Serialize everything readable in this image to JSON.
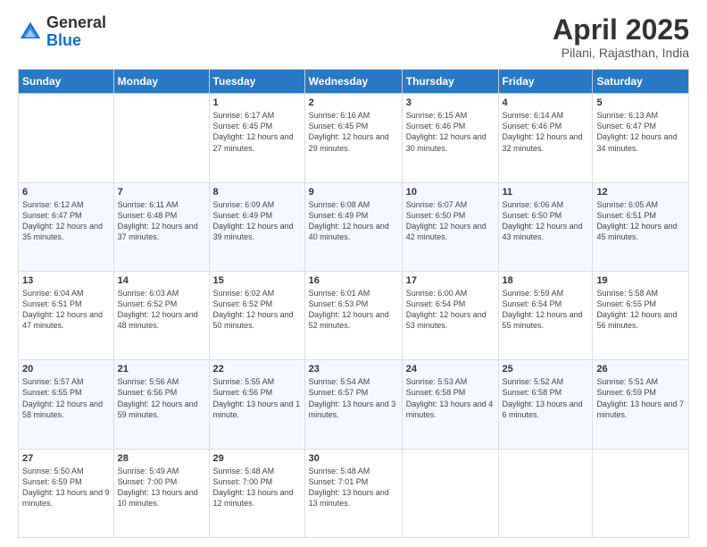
{
  "logo": {
    "general": "General",
    "blue": "Blue"
  },
  "header": {
    "month": "April 2025",
    "location": "Pilani, Rajasthan, India"
  },
  "weekdays": [
    "Sunday",
    "Monday",
    "Tuesday",
    "Wednesday",
    "Thursday",
    "Friday",
    "Saturday"
  ],
  "weeks": [
    [
      {
        "day": "",
        "info": ""
      },
      {
        "day": "",
        "info": ""
      },
      {
        "day": "1",
        "info": "Sunrise: 6:17 AM\nSunset: 6:45 PM\nDaylight: 12 hours and 27 minutes."
      },
      {
        "day": "2",
        "info": "Sunrise: 6:16 AM\nSunset: 6:45 PM\nDaylight: 12 hours and 29 minutes."
      },
      {
        "day": "3",
        "info": "Sunrise: 6:15 AM\nSunset: 6:46 PM\nDaylight: 12 hours and 30 minutes."
      },
      {
        "day": "4",
        "info": "Sunrise: 6:14 AM\nSunset: 6:46 PM\nDaylight: 12 hours and 32 minutes."
      },
      {
        "day": "5",
        "info": "Sunrise: 6:13 AM\nSunset: 6:47 PM\nDaylight: 12 hours and 34 minutes."
      }
    ],
    [
      {
        "day": "6",
        "info": "Sunrise: 6:12 AM\nSunset: 6:47 PM\nDaylight: 12 hours and 35 minutes."
      },
      {
        "day": "7",
        "info": "Sunrise: 6:11 AM\nSunset: 6:48 PM\nDaylight: 12 hours and 37 minutes."
      },
      {
        "day": "8",
        "info": "Sunrise: 6:09 AM\nSunset: 6:49 PM\nDaylight: 12 hours and 39 minutes."
      },
      {
        "day": "9",
        "info": "Sunrise: 6:08 AM\nSunset: 6:49 PM\nDaylight: 12 hours and 40 minutes."
      },
      {
        "day": "10",
        "info": "Sunrise: 6:07 AM\nSunset: 6:50 PM\nDaylight: 12 hours and 42 minutes."
      },
      {
        "day": "11",
        "info": "Sunrise: 6:06 AM\nSunset: 6:50 PM\nDaylight: 12 hours and 43 minutes."
      },
      {
        "day": "12",
        "info": "Sunrise: 6:05 AM\nSunset: 6:51 PM\nDaylight: 12 hours and 45 minutes."
      }
    ],
    [
      {
        "day": "13",
        "info": "Sunrise: 6:04 AM\nSunset: 6:51 PM\nDaylight: 12 hours and 47 minutes."
      },
      {
        "day": "14",
        "info": "Sunrise: 6:03 AM\nSunset: 6:52 PM\nDaylight: 12 hours and 48 minutes."
      },
      {
        "day": "15",
        "info": "Sunrise: 6:02 AM\nSunset: 6:52 PM\nDaylight: 12 hours and 50 minutes."
      },
      {
        "day": "16",
        "info": "Sunrise: 6:01 AM\nSunset: 6:53 PM\nDaylight: 12 hours and 52 minutes."
      },
      {
        "day": "17",
        "info": "Sunrise: 6:00 AM\nSunset: 6:54 PM\nDaylight: 12 hours and 53 minutes."
      },
      {
        "day": "18",
        "info": "Sunrise: 5:59 AM\nSunset: 6:54 PM\nDaylight: 12 hours and 55 minutes."
      },
      {
        "day": "19",
        "info": "Sunrise: 5:58 AM\nSunset: 6:55 PM\nDaylight: 12 hours and 56 minutes."
      }
    ],
    [
      {
        "day": "20",
        "info": "Sunrise: 5:57 AM\nSunset: 6:55 PM\nDaylight: 12 hours and 58 minutes."
      },
      {
        "day": "21",
        "info": "Sunrise: 5:56 AM\nSunset: 6:56 PM\nDaylight: 12 hours and 59 minutes."
      },
      {
        "day": "22",
        "info": "Sunrise: 5:55 AM\nSunset: 6:56 PM\nDaylight: 13 hours and 1 minute."
      },
      {
        "day": "23",
        "info": "Sunrise: 5:54 AM\nSunset: 6:57 PM\nDaylight: 13 hours and 3 minutes."
      },
      {
        "day": "24",
        "info": "Sunrise: 5:53 AM\nSunset: 6:58 PM\nDaylight: 13 hours and 4 minutes."
      },
      {
        "day": "25",
        "info": "Sunrise: 5:52 AM\nSunset: 6:58 PM\nDaylight: 13 hours and 6 minutes."
      },
      {
        "day": "26",
        "info": "Sunrise: 5:51 AM\nSunset: 6:59 PM\nDaylight: 13 hours and 7 minutes."
      }
    ],
    [
      {
        "day": "27",
        "info": "Sunrise: 5:50 AM\nSunset: 6:59 PM\nDaylight: 13 hours and 9 minutes."
      },
      {
        "day": "28",
        "info": "Sunrise: 5:49 AM\nSunset: 7:00 PM\nDaylight: 13 hours and 10 minutes."
      },
      {
        "day": "29",
        "info": "Sunrise: 5:48 AM\nSunset: 7:00 PM\nDaylight: 13 hours and 12 minutes."
      },
      {
        "day": "30",
        "info": "Sunrise: 5:48 AM\nSunset: 7:01 PM\nDaylight: 13 hours and 13 minutes."
      },
      {
        "day": "",
        "info": ""
      },
      {
        "day": "",
        "info": ""
      },
      {
        "day": "",
        "info": ""
      }
    ]
  ]
}
